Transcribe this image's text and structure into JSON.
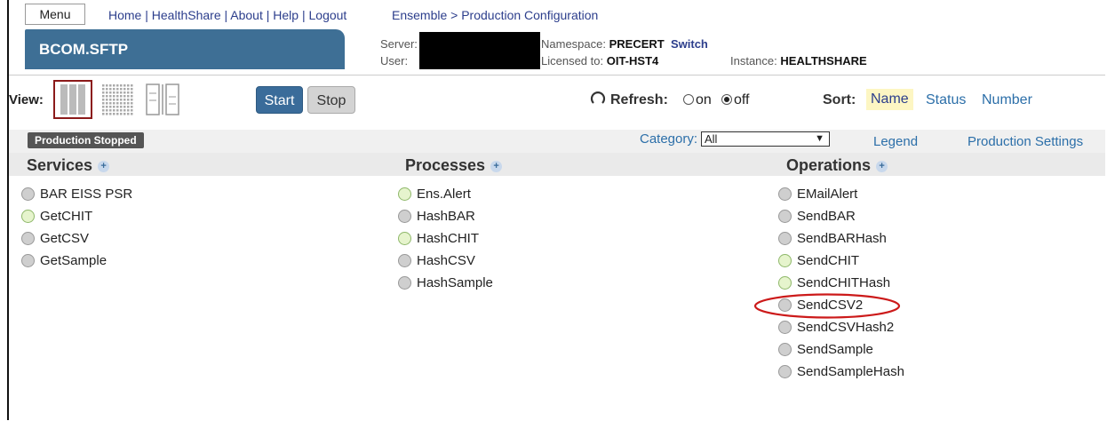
{
  "topbar": {
    "menu_label": "Menu",
    "links": [
      "Home",
      "HealthShare",
      "About",
      "Help",
      "Logout"
    ],
    "breadcrumb": "Ensemble > Production Configuration"
  },
  "production": {
    "name": "BCOM.SFTP",
    "server_label": "Server:",
    "user_label": "User:",
    "namespace_label": "Namespace:",
    "namespace": "PRECERT",
    "switch_label": "Switch",
    "licensed_label": "Licensed to:",
    "licensed_to": "OIT-HST4",
    "instance_label": "Instance:",
    "instance": "HEALTHSHARE"
  },
  "toolbar": {
    "view_label": "View:",
    "start_label": "Start",
    "stop_label": "Stop",
    "refresh_label": "Refresh:",
    "refresh_on": "on",
    "refresh_off": "off",
    "refresh_selected": "off",
    "sort_label": "Sort:",
    "sort_name": "Name",
    "sort_status": "Status",
    "sort_number": "Number"
  },
  "status": {
    "badge": "Production Stopped",
    "category_label": "Category:",
    "category_value": "All",
    "legend_label": "Legend",
    "settings_label": "Production Settings"
  },
  "columns": {
    "services": {
      "title": "Services",
      "items": [
        {
          "name": "BAR EISS PSR",
          "state": "grey"
        },
        {
          "name": "GetCHIT",
          "state": "green"
        },
        {
          "name": "GetCSV",
          "state": "grey"
        },
        {
          "name": "GetSample",
          "state": "grey"
        }
      ]
    },
    "processes": {
      "title": "Processes",
      "items": [
        {
          "name": "Ens.Alert",
          "state": "green"
        },
        {
          "name": "HashBAR",
          "state": "grey"
        },
        {
          "name": "HashCHIT",
          "state": "green"
        },
        {
          "name": "HashCSV",
          "state": "grey"
        },
        {
          "name": "HashSample",
          "state": "grey"
        }
      ]
    },
    "operations": {
      "title": "Operations",
      "items": [
        {
          "name": "EMailAlert",
          "state": "grey"
        },
        {
          "name": "SendBAR",
          "state": "grey"
        },
        {
          "name": "SendBARHash",
          "state": "grey"
        },
        {
          "name": "SendCHIT",
          "state": "green"
        },
        {
          "name": "SendCHITHash",
          "state": "green"
        },
        {
          "name": "SendCSV2",
          "state": "grey"
        },
        {
          "name": "SendCSVHash2",
          "state": "grey"
        },
        {
          "name": "SendSample",
          "state": "grey"
        },
        {
          "name": "SendSampleHash",
          "state": "grey"
        }
      ]
    }
  },
  "colors": {
    "title_bg": "#3e6f95",
    "status_grey": "#cfcfcf",
    "status_green": "#e6f4cd",
    "highlight_ellipse": "#cc1a1a"
  }
}
